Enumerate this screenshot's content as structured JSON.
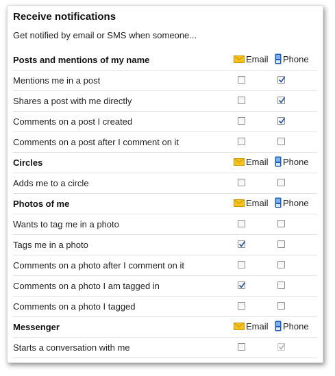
{
  "title": "Receive notifications",
  "subtitle": "Get notified by email or SMS when someone...",
  "labels": {
    "email": "Email",
    "phone": "Phone"
  },
  "colors": {
    "envelope": "#f4c21a",
    "phone": "#1d5fb5",
    "check": "#2b5aa6",
    "check_disabled": "#b8b8b8"
  },
  "sections": [
    {
      "heading": "Posts and mentions of my name",
      "rows": [
        {
          "label": "Mentions me in a post",
          "email": false,
          "phone": true,
          "phone_disabled": false
        },
        {
          "label": "Shares a post with me directly",
          "email": false,
          "phone": true,
          "phone_disabled": false
        },
        {
          "label": "Comments on a post I created",
          "email": false,
          "phone": true,
          "phone_disabled": false
        },
        {
          "label": "Comments on a post after I comment on it",
          "email": false,
          "phone": false,
          "phone_disabled": false
        }
      ]
    },
    {
      "heading": "Circles",
      "rows": [
        {
          "label": "Adds me to a circle",
          "email": false,
          "phone": false,
          "phone_disabled": false
        }
      ]
    },
    {
      "heading": "Photos of me",
      "rows": [
        {
          "label": "Wants to tag me in a photo",
          "email": false,
          "phone": false,
          "phone_disabled": false
        },
        {
          "label": "Tags me in a photo",
          "email": true,
          "phone": false,
          "phone_disabled": false
        },
        {
          "label": "Comments on a photo after I comment on it",
          "email": false,
          "phone": false,
          "phone_disabled": false
        },
        {
          "label": "Comments on a photo I am tagged in",
          "email": true,
          "phone": false,
          "phone_disabled": false
        },
        {
          "label": "Comments on a photo I tagged",
          "email": false,
          "phone": false,
          "phone_disabled": false
        }
      ]
    },
    {
      "heading": "Messenger",
      "rows": [
        {
          "label": "Starts a conversation with me",
          "email": false,
          "phone": true,
          "phone_disabled": true
        }
      ]
    }
  ]
}
